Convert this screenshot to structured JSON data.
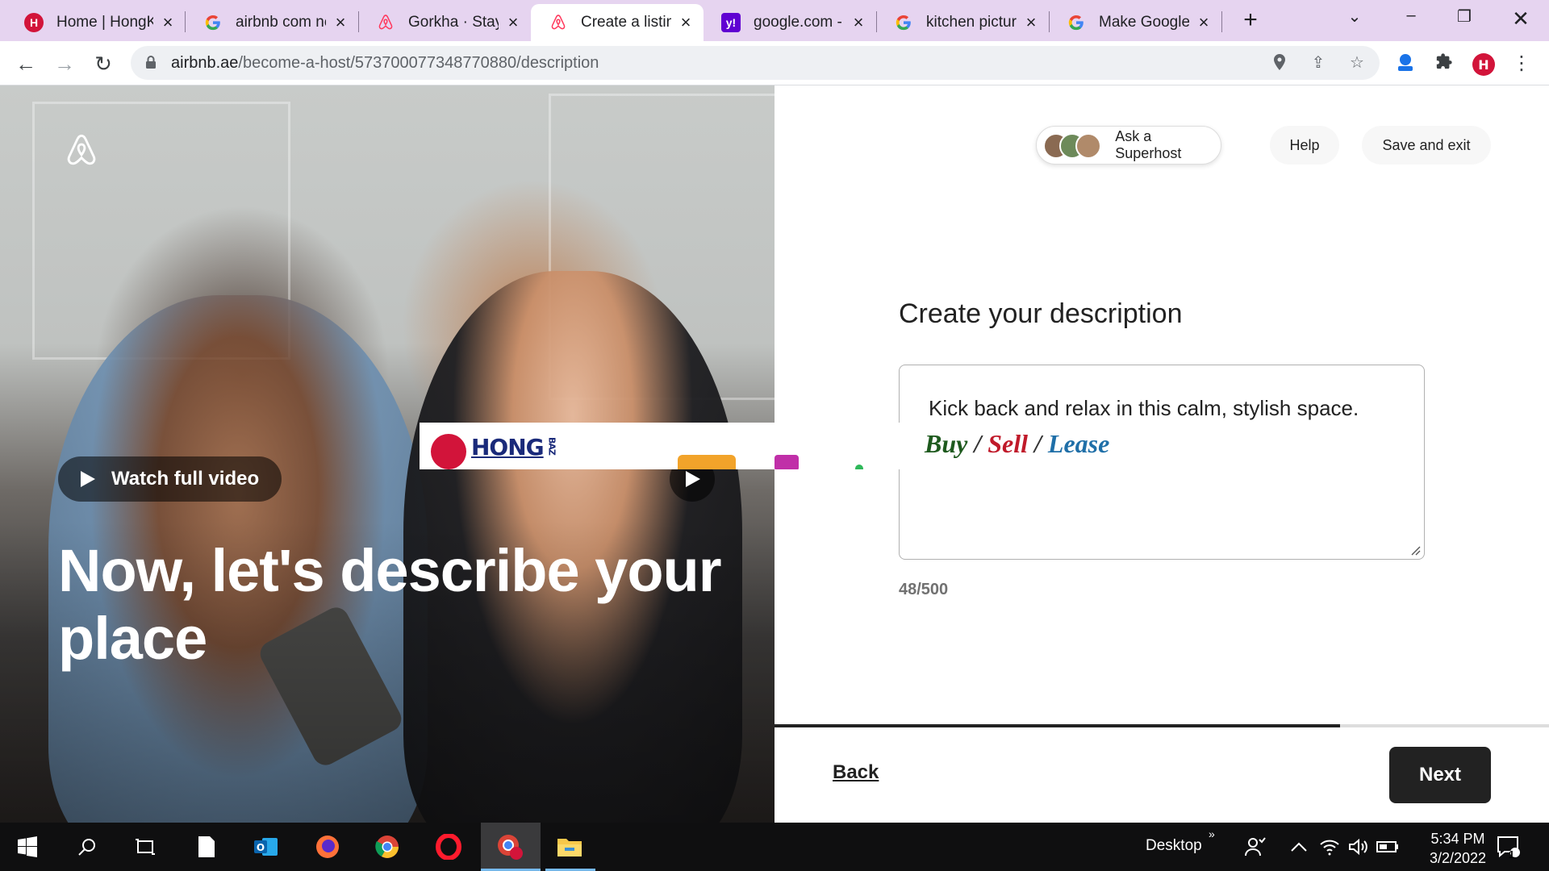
{
  "browser": {
    "tabs": [
      {
        "title": "Home | HongKong",
        "favicon": "hongkong-logo-icon",
        "active": false
      },
      {
        "title": "airbnb com new",
        "favicon": "google-icon",
        "active": false
      },
      {
        "title": "Gorkha · Stays",
        "favicon": "airbnb-icon",
        "active": false
      },
      {
        "title": "Create a listing",
        "favicon": "airbnb-icon",
        "active": true
      },
      {
        "title": "google.com - Yahoo",
        "favicon": "yahoo-icon",
        "active": false
      },
      {
        "title": "kitchen pictures",
        "favicon": "google-icon",
        "active": false
      },
      {
        "title": "Make Google your",
        "favicon": "google-icon",
        "active": false
      }
    ],
    "url_host": "airbnb.ae",
    "url_path": "/become-a-host/573700077348770880/description"
  },
  "page": {
    "hero_title": "Now, let's describe your place",
    "watch_label": "Watch full video",
    "ad": {
      "brand": "HONG",
      "brand_small": "BAZ",
      "buy": "Buy",
      "sell": "Sell",
      "lease": "Lease",
      "slash": "/"
    },
    "header": {
      "superhost_label": "Ask a Superhost",
      "help_label": "Help",
      "save_exit_label": "Save and exit"
    },
    "form": {
      "title": "Create your description",
      "description_value": "Kick back and relax in this calm, stylish space.",
      "counter": "48/500"
    },
    "footer": {
      "back_label": "Back",
      "next_label": "Next",
      "progress": 0.73
    }
  },
  "taskbar": {
    "desktop_label": "Desktop",
    "time": "5:34 PM",
    "date": "3/2/2022",
    "notification_count": "1"
  },
  "colors": {
    "tabbar": "#e6d4f0",
    "airbnb_brand": "#ff385c",
    "next_button": "#222222",
    "ad_buy": "#1e5a1e",
    "ad_sell": "#c01a2a",
    "ad_lease": "#1f6fa8"
  }
}
